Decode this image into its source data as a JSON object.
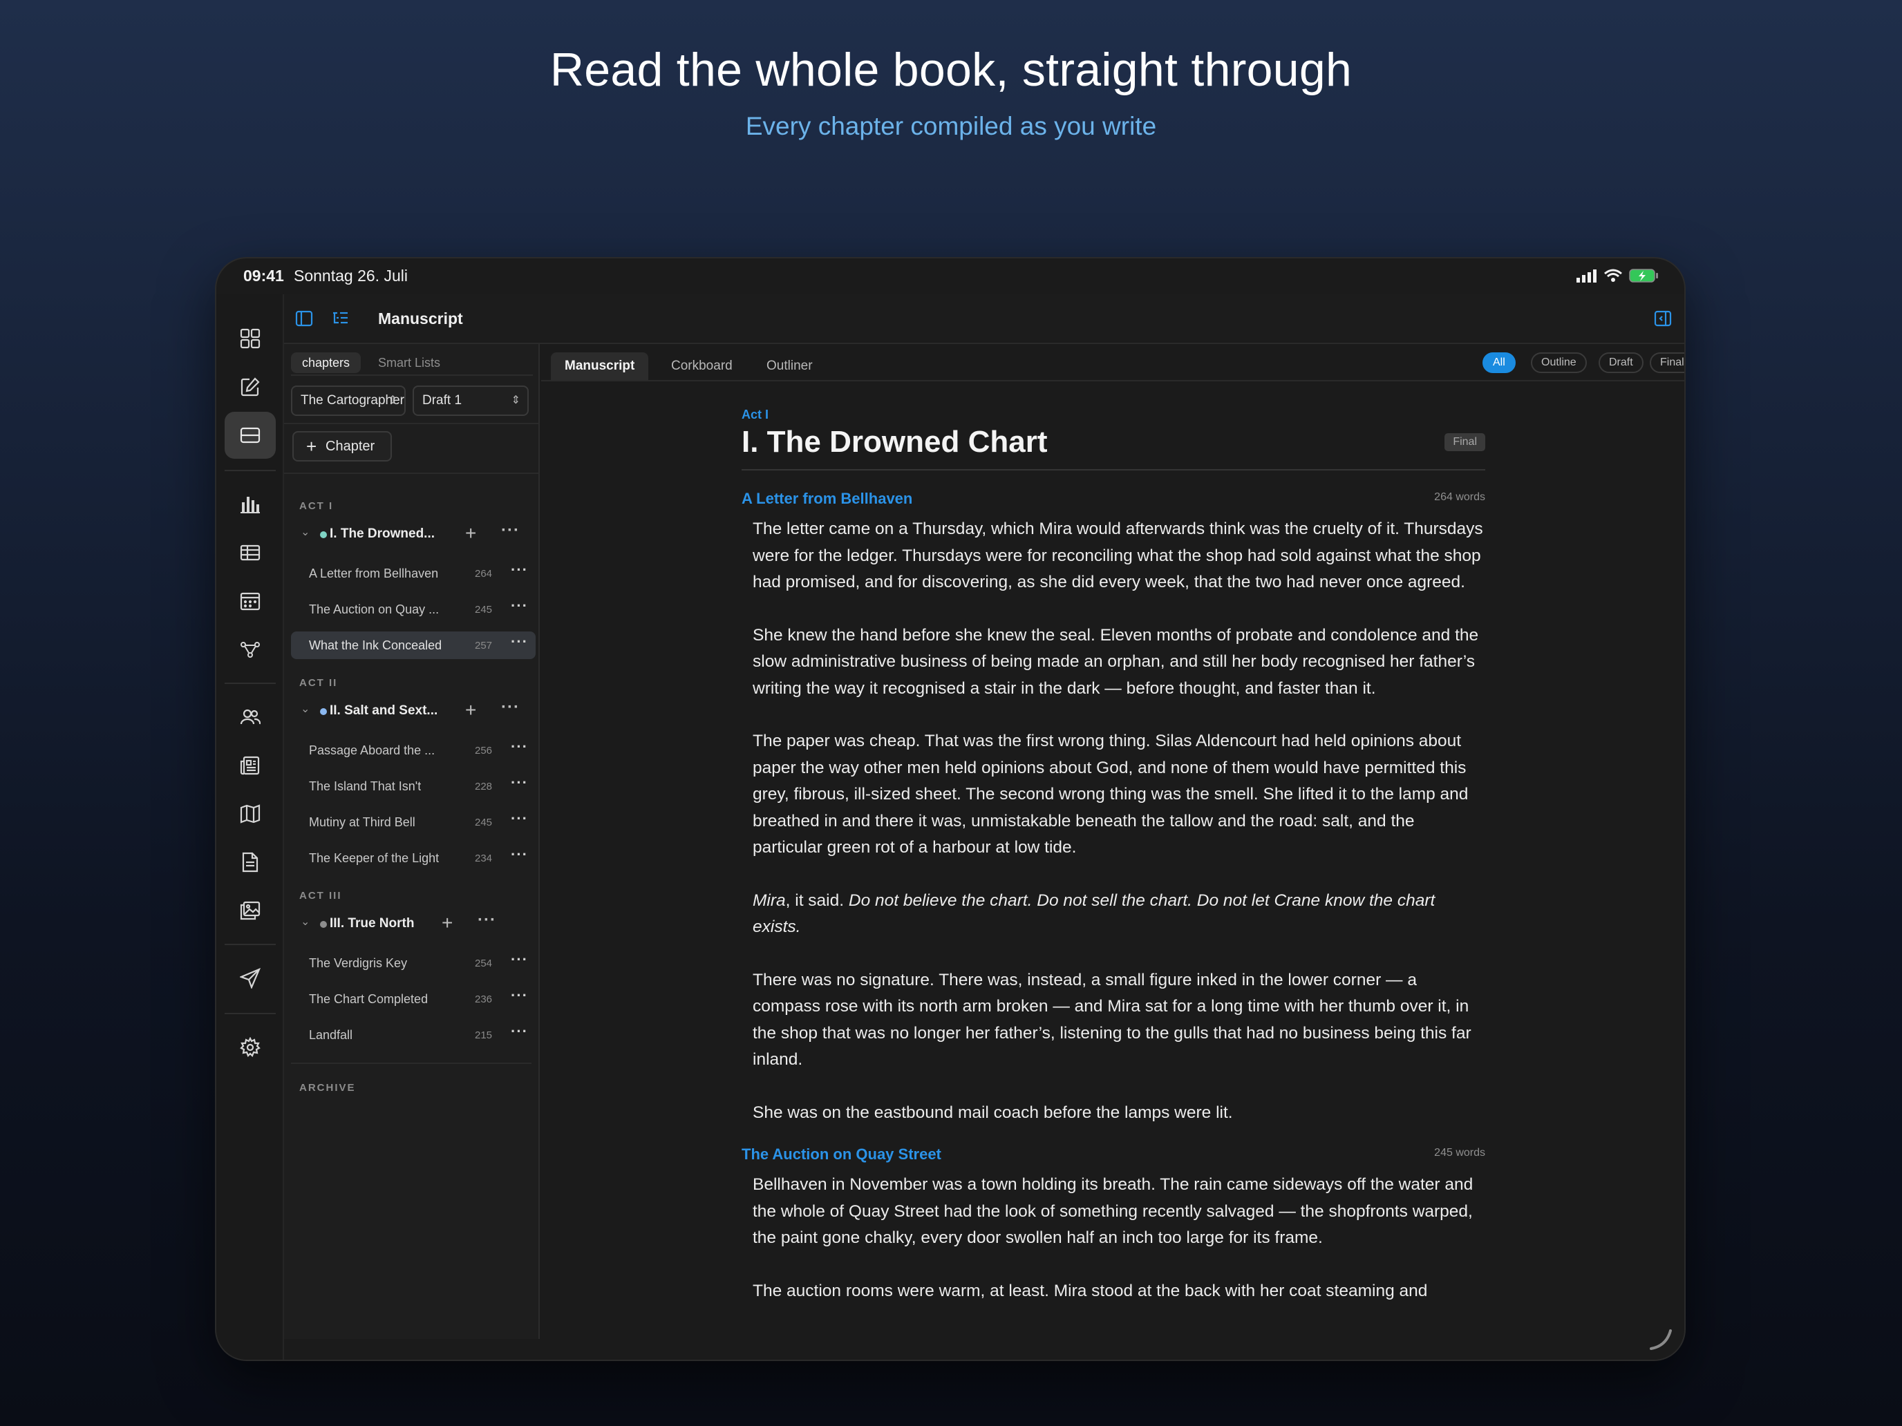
{
  "hero": {
    "title": "Read the whole book, straight through",
    "subtitle": "Every chapter compiled as you write"
  },
  "status_bar": {
    "time": "09:41",
    "date": "Sonntag 26. Juli"
  },
  "toolbar": {
    "title": "Manuscript"
  },
  "sidebar": {
    "segments": [
      "chapters",
      "Smart Lists"
    ],
    "book_select": "The Cartographer",
    "draft_select": "Draft 1",
    "add_chapter_label": "Chapter",
    "acts": [
      {
        "label": "ACT I",
        "chapter": "I. The Drowned...",
        "dot_color": "#7fd3c4",
        "scenes": [
          {
            "title": "A Letter from Bellhaven",
            "words": "264"
          },
          {
            "title": "The Auction on Quay ...",
            "words": "245"
          },
          {
            "title": "What the Ink Concealed",
            "words": "257"
          }
        ]
      },
      {
        "label": "ACT II",
        "chapter": "II. Salt and Sext...",
        "dot_color": "#8bb8f0",
        "scenes": [
          {
            "title": "Passage Aboard the ...",
            "words": "256"
          },
          {
            "title": "The Island That Isn't",
            "words": "228"
          },
          {
            "title": "Mutiny at Third Bell",
            "words": "245"
          },
          {
            "title": "The Keeper of the Light",
            "words": "234"
          }
        ]
      },
      {
        "label": "ACT III",
        "chapter": "III. True North",
        "dot_color": "#8e8e8e",
        "scenes": [
          {
            "title": "The Verdigris Key",
            "words": "254"
          },
          {
            "title": "The Chart Completed",
            "words": "236"
          },
          {
            "title": "Landfall",
            "words": "215"
          }
        ]
      }
    ],
    "archive_label": "ARCHIVE"
  },
  "main": {
    "tabs": [
      "Manuscript",
      "Corkboard",
      "Outliner"
    ],
    "filters": [
      "All",
      "Outline",
      "Draft",
      "Final"
    ],
    "act_kicker": "Act I",
    "chapter_title": "I. The Drowned Chart",
    "chapter_status": "Final",
    "scenes": [
      {
        "title": "A Letter from Bellhaven",
        "words": "264 words",
        "p1": "The letter came on a Thursday, which Mira would afterwards think was the cruelty of it. Thursdays were for the ledger. Thursdays were for reconciling what the shop had sold against what the shop had promised, and for discovering, as she did every week, that the two had never once agreed.",
        "p2": "She knew the hand before she knew the seal. Eleven months of probate and condolence and the slow administrative business of being made an orphan, and still her body recognised her father’s writing the way it recognised a stair in the dark — before thought, and faster than it.",
        "p3": "The paper was cheap. That was the first wrong thing. Silas Aldencourt had held opinions about paper the way other men held opinions about God, and none of them would have permitted this grey, fibrous, ill-sized sheet. The second wrong thing was the smell. She lifted it to the lamp and breathed in and there it was, unmistakable beneath the tallow and the road: salt, and the particular green rot of a harbour at low tide.",
        "p4_name": "Mira",
        "p4_mid": ", it said. ",
        "p4_quote": "Do not believe the chart. Do not sell the chart. Do not let Crane know the chart exists.",
        "p5": "There was no signature. There was, instead, a small figure inked in the lower corner — a compass rose with its north arm broken — and Mira sat for a long time with her thumb over it, in the shop that was no longer her father’s, listening to the gulls that had no business being this far inland.",
        "p6": "She was on the eastbound mail coach before the lamps were lit."
      },
      {
        "title": "The Auction on Quay Street",
        "words": "245 words",
        "p1": "Bellhaven in November was a town holding its breath. The rain came sideways off the water and the whole of Quay Street had the look of something recently salvaged — the shopfronts warped, the paint gone chalky, every door swollen half an inch too large for its frame.",
        "p2": "The auction rooms were warm, at least. Mira stood at the back with her coat steaming and"
      }
    ]
  },
  "colors": {
    "accent": "#2b93e8",
    "background": "#1b1b1b",
    "selected_row": "#34373c"
  },
  "icons": [
    "grid-icon",
    "compose-icon",
    "manuscript-icon",
    "stats-icon",
    "table-icon",
    "calendar-icon",
    "graph-icon",
    "characters-icon",
    "notes-icon",
    "map-icon",
    "document-icon",
    "media-icon",
    "send-icon",
    "settings-icon"
  ]
}
